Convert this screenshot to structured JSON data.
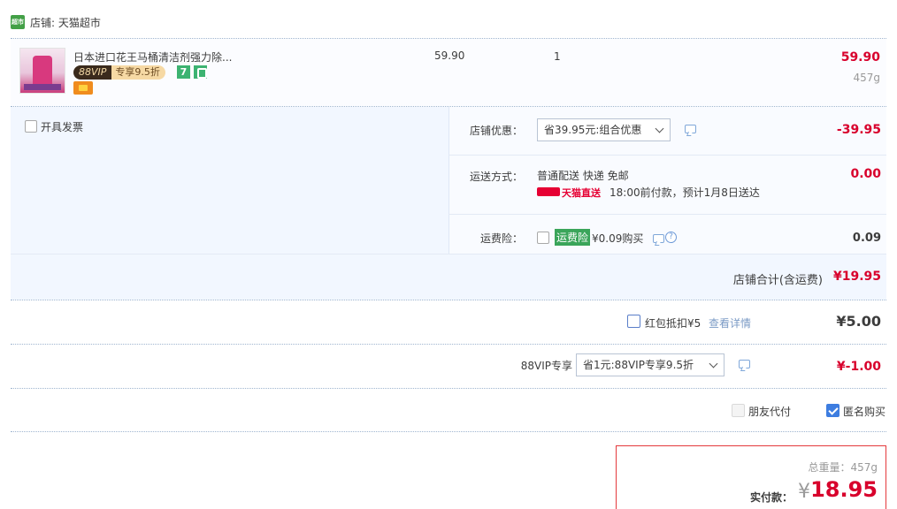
{
  "shop": {
    "logo_text": "超市",
    "name": "店铺: 天猫超市"
  },
  "item": {
    "title": "日本进口花王马桶清洁剂强力除...",
    "vip_left": "88VIP",
    "vip_right": "专享9.5折",
    "badge_seven": "7",
    "unit_price": "59.90",
    "quantity": "1",
    "total": "59.90",
    "weight": "457g"
  },
  "invoice": {
    "label": "开具发票"
  },
  "shop_discount": {
    "label": "店铺优惠：",
    "selected": "省39.95元:组合优惠",
    "amount": "-39.95"
  },
  "shipping": {
    "label": "运送方式：",
    "method": "普通配送 快递 免邮",
    "tmall_badge": "天猫直送",
    "eta": "18:00前付款，预计1月8日送达",
    "amount": "0.00"
  },
  "insurance": {
    "label": "运费险：",
    "tag": "运费险",
    "price": "¥0.09购买",
    "help": "?",
    "amount": "0.09"
  },
  "shop_total": {
    "label": "店铺合计(含运费)",
    "amount": "¥19.95"
  },
  "red_packet": {
    "label": "红包抵扣¥5",
    "link": "查看详情",
    "amount": "¥5.00"
  },
  "vip88": {
    "label": "88VIP专享",
    "selected": "省1元:88VIP专享9.5折",
    "amount": "¥-1.00"
  },
  "options": {
    "friend_pay": "朋友代付",
    "anonymous": "匿名购买"
  },
  "summary": {
    "weight": "总重量：457g",
    "pay_label": "实付款：",
    "currency": "¥",
    "pay_amount": "18.95"
  },
  "colors": {
    "accent_red": "#d8002c",
    "tmall_red": "#e60033",
    "link_blue": "#3d7de0",
    "insurance_green": "#3aa55a"
  }
}
